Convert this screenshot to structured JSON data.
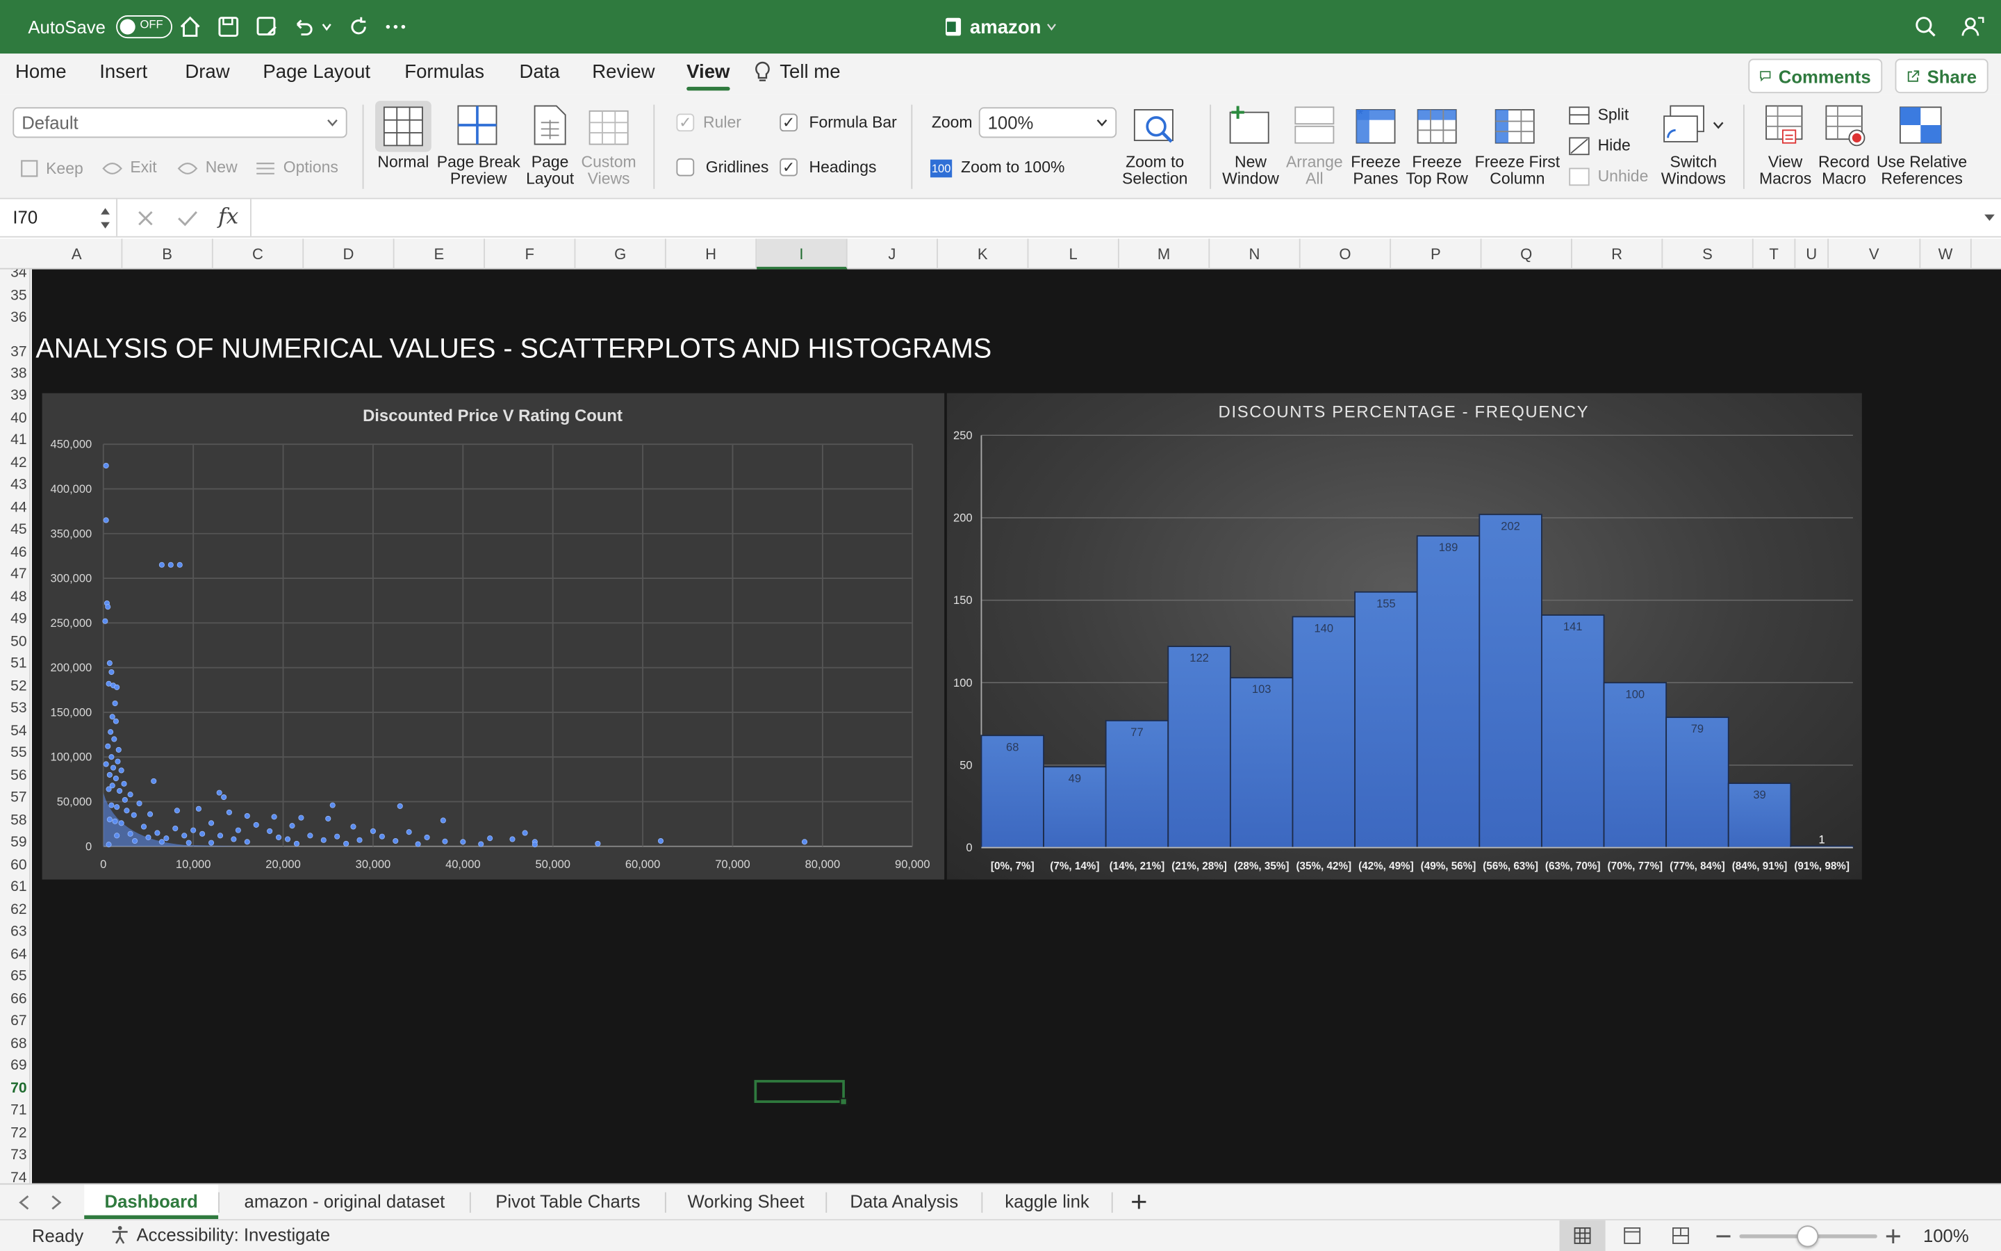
{
  "titlebar": {
    "autosave_label": "AutoSave",
    "autosave_state": "OFF",
    "document_name": "amazon"
  },
  "menu": [
    "Home",
    "Insert",
    "Draw",
    "Page Layout",
    "Formulas",
    "Data",
    "Review",
    "View"
  ],
  "tell_me": "Tell me",
  "comments_label": "Comments",
  "share_label": "Share",
  "ribbon": {
    "sheet_view_value": "Default",
    "keep": "Keep",
    "exit": "Exit",
    "new": "New",
    "options": "Options",
    "normal": "Normal",
    "page_break_1": "Page Break",
    "page_break_2": "Preview",
    "page_layout_1": "Page",
    "page_layout_2": "Layout",
    "custom_views_1": "Custom",
    "custom_views_2": "Views",
    "ruler": "Ruler",
    "formula_bar": "Formula Bar",
    "gridlines": "Gridlines",
    "headings": "Headings",
    "zoom_label": "Zoom",
    "zoom_value": "100%",
    "zoom_100_badge": "100",
    "zoom_to_100": "Zoom to 100%",
    "zoom_sel_1": "Zoom to",
    "zoom_sel_2": "Selection",
    "new_window_1": "New",
    "new_window_2": "Window",
    "arrange_1": "Arrange",
    "arrange_2": "All",
    "freeze_panes_1": "Freeze",
    "freeze_panes_2": "Panes",
    "freeze_top_1": "Freeze",
    "freeze_top_2": "Top Row",
    "freeze_first_1": "Freeze First",
    "freeze_first_2": "Column",
    "split": "Split",
    "hide": "Hide",
    "unhide": "Unhide",
    "switch_1": "Switch",
    "switch_2": "Windows",
    "view_macros_1": "View",
    "view_macros_2": "Macros",
    "record_1": "Record",
    "record_2": "Macro",
    "relative_1": "Use Relative",
    "relative_2": "References"
  },
  "formula": {
    "name_box": "I70",
    "fx": "fx",
    "content": ""
  },
  "columns": [
    "A",
    "B",
    "C",
    "D",
    "E",
    "F",
    "G",
    "H",
    "I",
    "J",
    "K",
    "L",
    "M",
    "N",
    "O",
    "P",
    "Q",
    "R",
    "S",
    "T",
    "U",
    "V",
    "W"
  ],
  "selected_column": "I",
  "rows": [
    "34",
    "35",
    "36",
    "37",
    "38",
    "39",
    "40",
    "41",
    "42",
    "43",
    "44",
    "45",
    "46",
    "47",
    "48",
    "49",
    "50",
    "51",
    "52",
    "53",
    "54",
    "55",
    "56",
    "57",
    "58",
    "59",
    "60",
    "61",
    "62",
    "63",
    "64",
    "65",
    "66",
    "67",
    "68",
    "69",
    "70",
    "71",
    "72",
    "73",
    "74"
  ],
  "selected_row": "70",
  "section_heading": "ANALYSIS OF NUMERICAL VALUES - SCATTERPLOTS AND HISTOGRAMS",
  "chart_data": [
    {
      "type": "scatter",
      "title": "Discounted Price V Rating Count",
      "xlabel": "",
      "ylabel": "",
      "xlim": [
        0,
        90000
      ],
      "ylim": [
        0,
        450000
      ],
      "x_ticks": [
        "0",
        "10,000",
        "20,000",
        "30,000",
        "40,000",
        "50,000",
        "60,000",
        "70,000",
        "80,000",
        "90,000"
      ],
      "y_ticks": [
        "0",
        "50,000",
        "100,000",
        "150,000",
        "200,000",
        "250,000",
        "300,000",
        "350,000",
        "400,000",
        "450,000"
      ],
      "grid": true,
      "color": "#5b8df0",
      "points": [
        [
          300,
          426000
        ],
        [
          300,
          365000
        ],
        [
          400,
          272000
        ],
        [
          500,
          268000
        ],
        [
          200,
          252000
        ],
        [
          6500,
          315000
        ],
        [
          7500,
          315000
        ],
        [
          8500,
          315000
        ],
        [
          700,
          205000
        ],
        [
          900,
          195000
        ],
        [
          600,
          182000
        ],
        [
          1100,
          180000
        ],
        [
          1500,
          178000
        ],
        [
          1300,
          160000
        ],
        [
          1000,
          145000
        ],
        [
          1400,
          140000
        ],
        [
          800,
          128000
        ],
        [
          1200,
          120000
        ],
        [
          500,
          112000
        ],
        [
          1700,
          108000
        ],
        [
          900,
          100000
        ],
        [
          1600,
          95000
        ],
        [
          300,
          92000
        ],
        [
          1100,
          88000
        ],
        [
          2000,
          85000
        ],
        [
          700,
          80000
        ],
        [
          1400,
          76000
        ],
        [
          5600,
          73000
        ],
        [
          2300,
          70000
        ],
        [
          1000,
          68000
        ],
        [
          600,
          64000
        ],
        [
          1800,
          62000
        ],
        [
          12900,
          60000
        ],
        [
          13400,
          55000
        ],
        [
          3000,
          58000
        ],
        [
          2400,
          52000
        ],
        [
          4000,
          48000
        ],
        [
          900,
          46000
        ],
        [
          1500,
          44000
        ],
        [
          25500,
          46000
        ],
        [
          33000,
          45000
        ],
        [
          8200,
          40000
        ],
        [
          10600,
          42000
        ],
        [
          2600,
          40000
        ],
        [
          14000,
          38000
        ],
        [
          5200,
          36000
        ],
        [
          3400,
          35000
        ],
        [
          16000,
          34000
        ],
        [
          19000,
          33000
        ],
        [
          22000,
          32000
        ],
        [
          25000,
          31000
        ],
        [
          37800,
          29000
        ],
        [
          700,
          30000
        ],
        [
          1300,
          28000
        ],
        [
          2000,
          26000
        ],
        [
          12000,
          26000
        ],
        [
          17000,
          24000
        ],
        [
          21000,
          23000
        ],
        [
          27800,
          22000
        ],
        [
          4500,
          22000
        ],
        [
          8000,
          20000
        ],
        [
          10000,
          18000
        ],
        [
          15000,
          18000
        ],
        [
          18500,
          17000
        ],
        [
          30000,
          17000
        ],
        [
          34000,
          16000
        ],
        [
          46900,
          15000
        ],
        [
          6000,
          15000
        ],
        [
          11000,
          14000
        ],
        [
          3000,
          14000
        ],
        [
          9000,
          12000
        ],
        [
          13000,
          12000
        ],
        [
          23000,
          12000
        ],
        [
          26000,
          11000
        ],
        [
          31000,
          11000
        ],
        [
          36000,
          10000
        ],
        [
          43000,
          9000
        ],
        [
          45500,
          8000
        ],
        [
          19500,
          10000
        ],
        [
          1500,
          12000
        ],
        [
          5000,
          10000
        ],
        [
          7000,
          9000
        ],
        [
          14500,
          8000
        ],
        [
          20500,
          8000
        ],
        [
          24500,
          7000
        ],
        [
          28500,
          7000
        ],
        [
          32500,
          6000
        ],
        [
          38000,
          5500
        ],
        [
          40000,
          5000
        ],
        [
          48000,
          5000
        ],
        [
          55000,
          3000
        ],
        [
          62000,
          6000
        ],
        [
          78000,
          5000
        ],
        [
          16000,
          5000
        ],
        [
          12000,
          4000
        ],
        [
          21500,
          3000
        ],
        [
          27000,
          3000
        ],
        [
          35000,
          2500
        ],
        [
          42000,
          2500
        ],
        [
          48000,
          2000
        ],
        [
          3500,
          6000
        ],
        [
          6500,
          5000
        ],
        [
          9500,
          4000
        ],
        [
          600,
          2000
        ]
      ]
    },
    {
      "type": "bar",
      "title": "DISCOUNTS PERCENTAGE - FREQUENCY",
      "xlabel": "",
      "ylabel": "",
      "categories": [
        "[0%, 7%]",
        "(7%, 14%]",
        "(14%, 21%]",
        "(21%, 28%]",
        "(28%, 35%]",
        "(35%, 42%]",
        "(42%, 49%]",
        "(49%, 56%]",
        "(56%, 63%]",
        "(63%, 70%]",
        "(70%, 77%]",
        "(77%, 84%]",
        "(84%, 91%]",
        "(91%, 98%]"
      ],
      "values": [
        68,
        49,
        77,
        122,
        103,
        140,
        155,
        189,
        202,
        141,
        100,
        79,
        39,
        1
      ],
      "ylim": [
        0,
        250
      ],
      "y_ticks": [
        "0",
        "50",
        "100",
        "150",
        "200",
        "250"
      ],
      "grid": true,
      "color": "#4472c4"
    }
  ],
  "sheet_tabs": [
    "Dashboard",
    "amazon - original dataset",
    "Pivot Table Charts",
    "Working Sheet",
    "Data Analysis",
    "kaggle link"
  ],
  "active_tab": "Dashboard",
  "status": {
    "ready": "Ready",
    "accessibility": "Accessibility: Investigate",
    "zoom": "100%"
  }
}
